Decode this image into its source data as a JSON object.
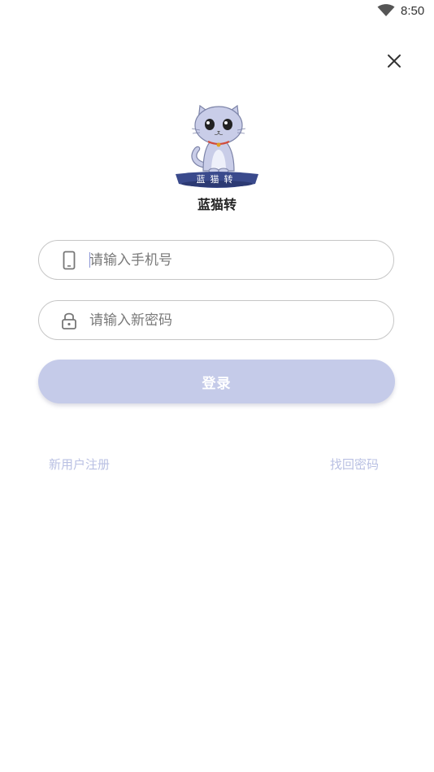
{
  "status_bar": {
    "time": "8:50",
    "wifi_icon": "wifi-icon"
  },
  "header": {
    "close_icon": "close-icon"
  },
  "logo": {
    "banner_text": "蓝猫转",
    "app_name": "蓝猫转"
  },
  "form": {
    "phone": {
      "icon": "phone-icon",
      "placeholder": "请输入手机号",
      "value": ""
    },
    "password": {
      "icon": "lock-icon",
      "placeholder": "请输入新密码",
      "value": ""
    },
    "login_label": "登录"
  },
  "links": {
    "register": "新用户注册",
    "forgot_password": "找回密码"
  },
  "colors": {
    "accent": "#c5cbe9",
    "link": "#b9c0e3",
    "logo_banner": "#3a4a8c",
    "cat_body": "#c9cde8"
  }
}
